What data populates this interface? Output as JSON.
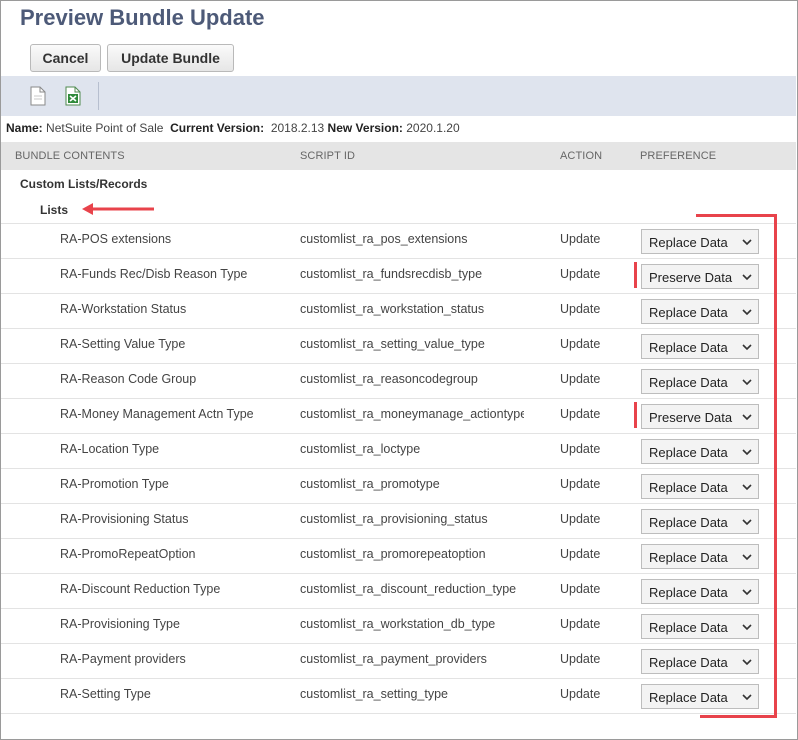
{
  "page": {
    "title": "Preview Bundle Update"
  },
  "buttons": {
    "cancel": "Cancel",
    "update": "Update Bundle"
  },
  "toolbar": {
    "icons": [
      "document-icon",
      "excel-export-icon"
    ]
  },
  "info": {
    "name_label": "Name:",
    "name_value": "NetSuite Point of Sale",
    "current_label": "Current Version:",
    "current_value": "2018.2.13",
    "new_label": "New Version:",
    "new_value": "2020.1.20"
  },
  "table": {
    "headers": [
      "BUNDLE CONTENTS",
      "SCRIPT ID",
      "ACTION",
      "PREFERENCE"
    ],
    "group": "Custom Lists/Records",
    "subgroup": "Lists",
    "rows": [
      {
        "name": "RA-POS extensions",
        "script_id": "customlist_ra_pos_extensions",
        "action": "Update",
        "preference": "Replace Data"
      },
      {
        "name": "RA-Funds Rec/Disb Reason Type",
        "script_id": "customlist_ra_fundsrecdisb_type",
        "action": "Update",
        "preference": "Preserve Data"
      },
      {
        "name": "RA-Workstation Status",
        "script_id": "customlist_ra_workstation_status",
        "action": "Update",
        "preference": "Replace Data"
      },
      {
        "name": "RA-Setting Value Type",
        "script_id": "customlist_ra_setting_value_type",
        "action": "Update",
        "preference": "Replace Data"
      },
      {
        "name": "RA-Reason Code Group",
        "script_id": "customlist_ra_reasoncodegroup",
        "action": "Update",
        "preference": "Replace Data"
      },
      {
        "name": "RA-Money Management Actn Type",
        "script_id": "customlist_ra_moneymanage_actiontype",
        "action": "Update",
        "preference": "Preserve Data"
      },
      {
        "name": "RA-Location Type",
        "script_id": "customlist_ra_loctype",
        "action": "Update",
        "preference": "Replace Data"
      },
      {
        "name": "RA-Promotion Type",
        "script_id": "customlist_ra_promotype",
        "action": "Update",
        "preference": "Replace Data"
      },
      {
        "name": "RA-Provisioning Status",
        "script_id": "customlist_ra_provisioning_status",
        "action": "Update",
        "preference": "Replace Data"
      },
      {
        "name": "RA-PromoRepeatOption",
        "script_id": "customlist_ra_promorepeatoption",
        "action": "Update",
        "preference": "Replace Data"
      },
      {
        "name": "RA-Discount Reduction Type",
        "script_id": "customlist_ra_discount_reduction_type",
        "action": "Update",
        "preference": "Replace Data"
      },
      {
        "name": "RA-Provisioning Type",
        "script_id": "customlist_ra_workstation_db_type",
        "action": "Update",
        "preference": "Replace Data"
      },
      {
        "name": "RA-Payment providers",
        "script_id": "customlist_ra_payment_providers",
        "action": "Update",
        "preference": "Replace Data"
      },
      {
        "name": "RA-Setting Type",
        "script_id": "customlist_ra_setting_type",
        "action": "Update",
        "preference": "Replace Data"
      }
    ]
  },
  "annotation": {
    "color": "#e8434b",
    "marked_rows": [
      1,
      5
    ]
  }
}
